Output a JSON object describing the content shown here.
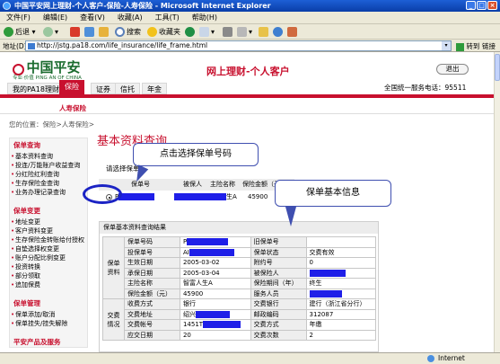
{
  "window": {
    "title": "中国平安网上理财-个人客户-保险-人寿保险 - Microsoft Internet Explorer"
  },
  "menu": [
    "文件(F)",
    "编辑(E)",
    "查看(V)",
    "收藏(A)",
    "工具(T)",
    "帮助(H)"
  ],
  "toolbar": {
    "back": "后退",
    "search": "搜索",
    "favorites": "收藏夹"
  },
  "address": {
    "label": "地址(D)",
    "url": "http://jstg.pa18.com/life_insurance/life_frame.html",
    "go": "转到",
    "links": "链接"
  },
  "header": {
    "logo": "中国平安",
    "logo_sub": "PING AN OF CHINA",
    "logo_tag": "专业·价值",
    "site_title": "网上理财-个人客户",
    "exit": "退出",
    "hotline": "全国统一服务电话：95511",
    "tabs": [
      "我的PA18理财",
      "保险",
      "证券",
      "信托",
      "年金"
    ],
    "subtab": "人寿保险"
  },
  "breadcrumb": "您的位置：保险>人寿保险>",
  "sidebar": [
    {
      "head": "保单查询",
      "items": [
        "基本资料查询",
        "投连/万能账户收益查询",
        "分红险红利查询",
        "生存保险金查询",
        "业务办理记录查询"
      ]
    },
    {
      "head": "保单变更",
      "items": [
        "地址变更",
        "客户资料变更",
        "生存保险金转账给付授权",
        "自垫选择权变更",
        "账户分配比例变更",
        "投资转换",
        "部分领取",
        "追加保费"
      ]
    },
    {
      "head": "保单管理",
      "items": [
        "保单添加/取消",
        "保单挂失/挂失解除"
      ]
    },
    {
      "head": "平安产品及服务",
      "items": []
    }
  ],
  "main": {
    "title": "基本资料查询",
    "select_prompt": "请选择保单",
    "list_headers": [
      "保单号",
      "被保人",
      "主险名称",
      "保险金额（元）"
    ],
    "list_row": {
      "policy": "P",
      "insured": "",
      "product": "生A",
      "amount": "45900"
    },
    "detail_title": "保单基本资料查询结果",
    "detail_rows": [
      {
        "group": "保单资料",
        "l1": "保单号码",
        "v1": "P",
        "l2": "旧保单号",
        "v2": ""
      },
      {
        "group": "",
        "l1": "投保单号",
        "v1": "AI",
        "l2": "保单状态",
        "v2": "交费有效"
      },
      {
        "group": "",
        "l1": "生效日期",
        "v1": "2005-03-02",
        "l2": "附约号",
        "v2": "0"
      },
      {
        "group": "",
        "l1": "承保日期",
        "v1": "2005-03-04",
        "l2": "被保险人",
        "v2": ""
      },
      {
        "group": "",
        "l1": "主险名称",
        "v1": "智富人生A",
        "l2": "保险期间（年）",
        "v2": "终生"
      },
      {
        "group": "",
        "l1": "保险金额（元）",
        "v1": "45900",
        "l2": "服务人员",
        "v2": ""
      },
      {
        "group": "交费情况",
        "l1": "收费方式",
        "v1": "银行",
        "l2": "交费银行",
        "v2": "建行（浙江省分行）"
      },
      {
        "group": "",
        "l1": "交费地址",
        "v1": "绍兴",
        "l2": "邮政编码",
        "v2": "312087"
      },
      {
        "group": "",
        "l1": "交费帐号",
        "v1": "1451T",
        "l2": "交费方式",
        "v2": "年缴"
      },
      {
        "group": "",
        "l1": "应交日期",
        "v1": "20",
        "l2": "交费次数",
        "v2": "2"
      }
    ]
  },
  "callouts": {
    "select": "点击选择保单号码",
    "info": "保单基本信息"
  },
  "status": {
    "text": "",
    "zone": "Internet"
  },
  "colors": {
    "brand_red": "#c8102e",
    "brand_green": "#1a6b2e",
    "highlight_blue": "#1f1fe8"
  }
}
